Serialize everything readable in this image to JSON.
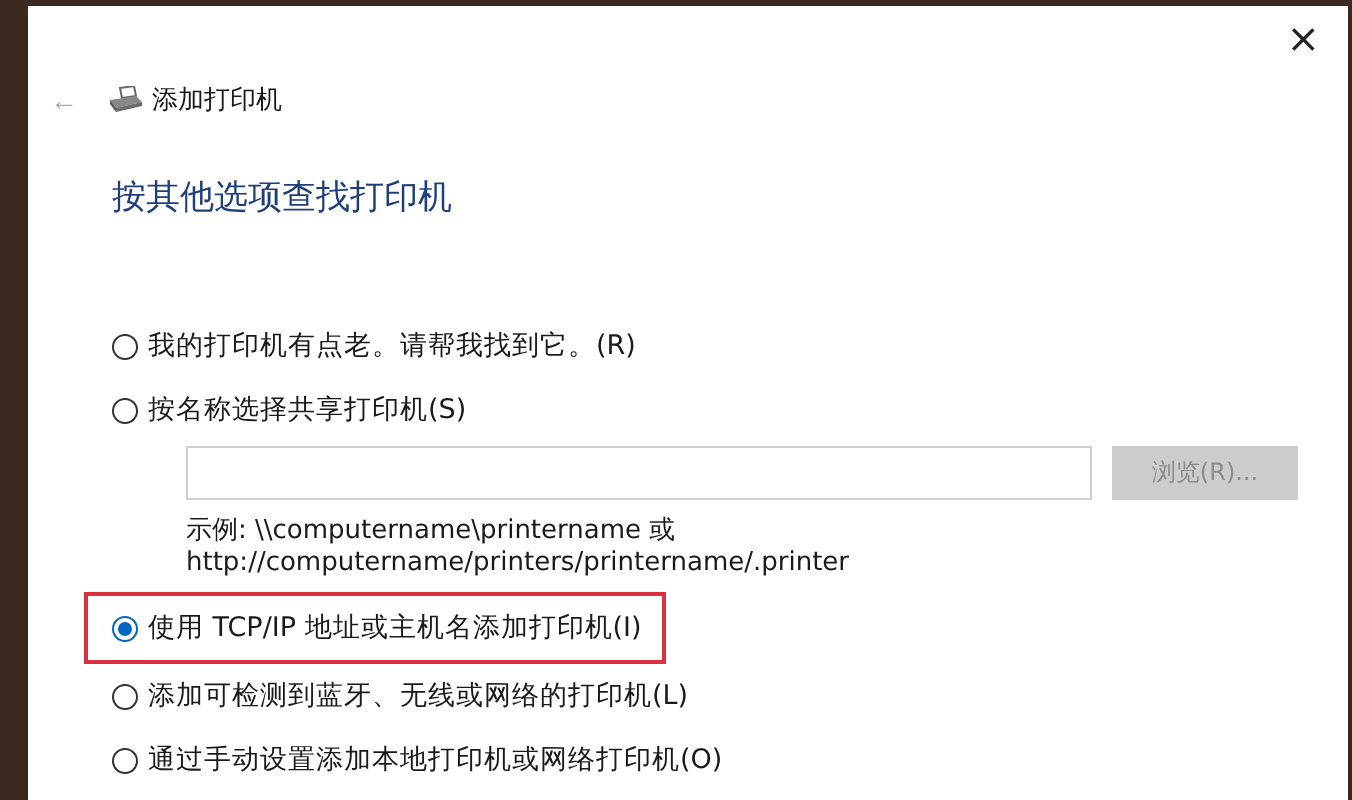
{
  "window": {
    "close": "×",
    "back": "←",
    "title": "添加打印机"
  },
  "heading": "按其他选项查找打印机",
  "options": [
    {
      "kind": "plain",
      "label": "我的打印机有点老。请帮我找到它。(R)",
      "selected": false,
      "highlighted": false
    },
    {
      "kind": "shared",
      "label": "按名称选择共享打印机(S)",
      "selected": false,
      "highlighted": false,
      "browse_button": {
        "label": "浏览(R)...",
        "disabled": true
      },
      "example": [
        "示例: \\\\computername\\printername 或",
        "http://computername/printers/printername/.printer"
      ]
    },
    {
      "kind": "plain",
      "label": "使用 TCP/IP 地址或主机名添加打印机(I)",
      "selected": true,
      "highlighted": true
    },
    {
      "kind": "plain",
      "label": "添加可检测到蓝牙、无线或网络的打印机(L)",
      "selected": false,
      "highlighted": false
    },
    {
      "kind": "plain",
      "label": "通过手动设置添加本地打印机或网络打印机(O)",
      "selected": false,
      "highlighted": false
    }
  ]
}
